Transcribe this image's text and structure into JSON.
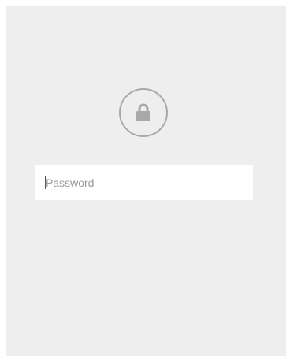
{
  "lock_screen": {
    "icon": "lock-icon",
    "password": {
      "value": "",
      "placeholder": "Password"
    }
  },
  "colors": {
    "panel_background": "#eeeeee",
    "input_background": "#ffffff",
    "icon_gray": "#a8a8a8",
    "placeholder_gray": "#9b9b9b"
  }
}
